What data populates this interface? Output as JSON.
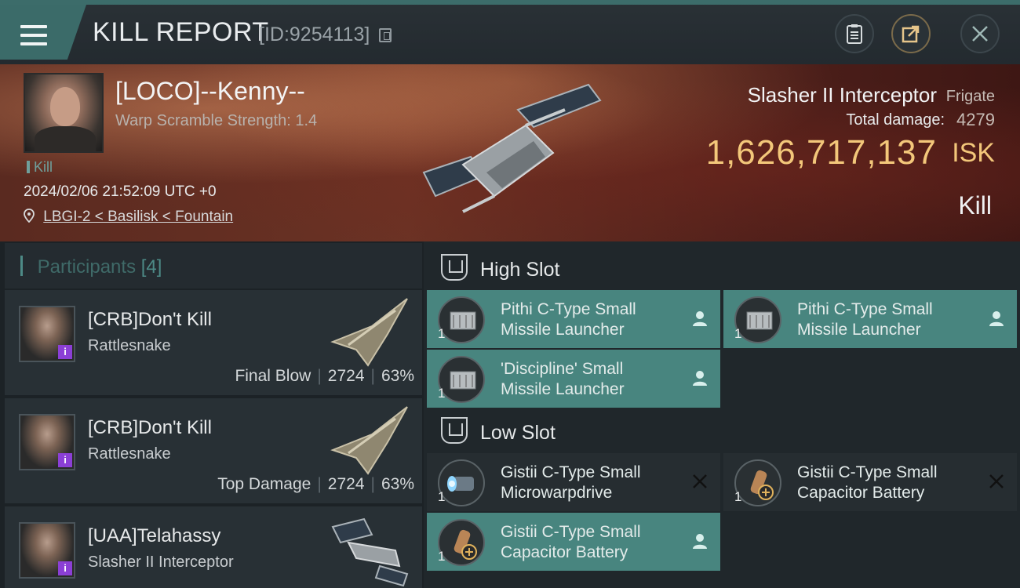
{
  "header": {
    "title": "KILL REPORT",
    "report_id": "[ID:9254113]",
    "icons": [
      "menu-icon",
      "copy-icon",
      "clipboard-icon",
      "share-icon",
      "close-icon"
    ]
  },
  "victim": {
    "name": "[LOCO]--Kenny--",
    "warp_scramble": "Warp Scramble Strength: 1.4",
    "tag": "Kill",
    "datetime": "2024/02/06 21:52:09 UTC +0",
    "location": "LBGI-2 < Basilisk < Fountain",
    "ship_name": "Slasher II Interceptor",
    "ship_class": "Frigate",
    "total_damage_label": "Total damage:",
    "total_damage": "4279",
    "isk_value": "1,626,717,137",
    "isk_unit": "ISK",
    "result": "Kill"
  },
  "participants": {
    "label": "Participants",
    "count": "[4]",
    "rows": [
      {
        "name": "[CRB]Don't Kill",
        "ship": "Rattlesnake",
        "role": "Final Blow",
        "damage": "2724",
        "percent": "63%",
        "badge": "i"
      },
      {
        "name": "[CRB]Don't Kill",
        "ship": "Rattlesnake",
        "role": "Top Damage",
        "damage": "2724",
        "percent": "63%",
        "badge": "i"
      },
      {
        "name": "[UAA]Telahassy",
        "ship": "Slasher II Interceptor",
        "role": "",
        "damage": "",
        "percent": "",
        "badge": "i"
      }
    ]
  },
  "slots": {
    "high": {
      "label": "High Slot",
      "modules": [
        {
          "line1": "Pithi C-Type Small",
          "line2": "Missile Launcher",
          "qty": "1",
          "status": "dropped"
        },
        {
          "line1": "Pithi C-Type Small",
          "line2": "Missile Launcher",
          "qty": "1",
          "status": "dropped"
        },
        {
          "line1": "'Discipline' Small",
          "line2": "Missile Launcher",
          "qty": "1",
          "status": "dropped"
        }
      ]
    },
    "low": {
      "label": "Low Slot",
      "modules": [
        {
          "line1": "Gistii C-Type Small",
          "line2": "Microwarpdrive",
          "qty": "1",
          "status": "destroyed"
        },
        {
          "line1": "Gistii C-Type Small",
          "line2": "Capacitor Battery",
          "qty": "1",
          "status": "destroyed"
        },
        {
          "line1": "Gistii C-Type Small",
          "line2": "Capacitor Battery",
          "qty": "1",
          "status": "dropped"
        }
      ]
    }
  },
  "colors": {
    "accent_teal": "#48857f",
    "isk_gold": "#f3c77a",
    "badge_purple": "#8b3fd6"
  }
}
